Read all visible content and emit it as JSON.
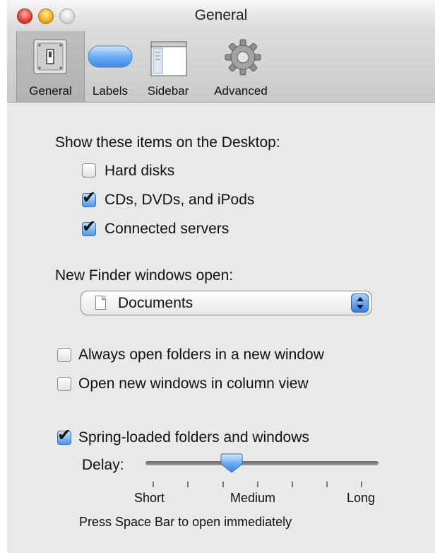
{
  "window": {
    "title": "General"
  },
  "toolbar": {
    "tabs": [
      {
        "label": "General",
        "icon": "general-switch-icon",
        "selected": true
      },
      {
        "label": "Labels",
        "icon": "labels-pill-icon",
        "selected": false
      },
      {
        "label": "Sidebar",
        "icon": "sidebar-window-icon",
        "selected": false
      },
      {
        "label": "Advanced",
        "icon": "gear-icon",
        "selected": false
      }
    ]
  },
  "desktop_items": {
    "heading": "Show these items on the Desktop:",
    "options": [
      {
        "label": "Hard disks",
        "checked": false
      },
      {
        "label": "CDs, DVDs, and iPods",
        "checked": true
      },
      {
        "label": "Connected servers",
        "checked": true
      }
    ]
  },
  "new_window": {
    "heading": "New Finder windows open:",
    "selected_value": "Documents"
  },
  "window_options": [
    {
      "label": "Always open folders in a new window",
      "checked": false
    },
    {
      "label": "Open new windows in column view",
      "checked": false
    }
  ],
  "spring_loaded": {
    "label": "Spring-loaded folders and windows",
    "checked": true,
    "delay_label": "Delay:",
    "delay_value": 0.37,
    "tick_labels": {
      "short": "Short",
      "medium": "Medium",
      "long": "Long"
    },
    "hint": "Press Space Bar to open immediately"
  }
}
